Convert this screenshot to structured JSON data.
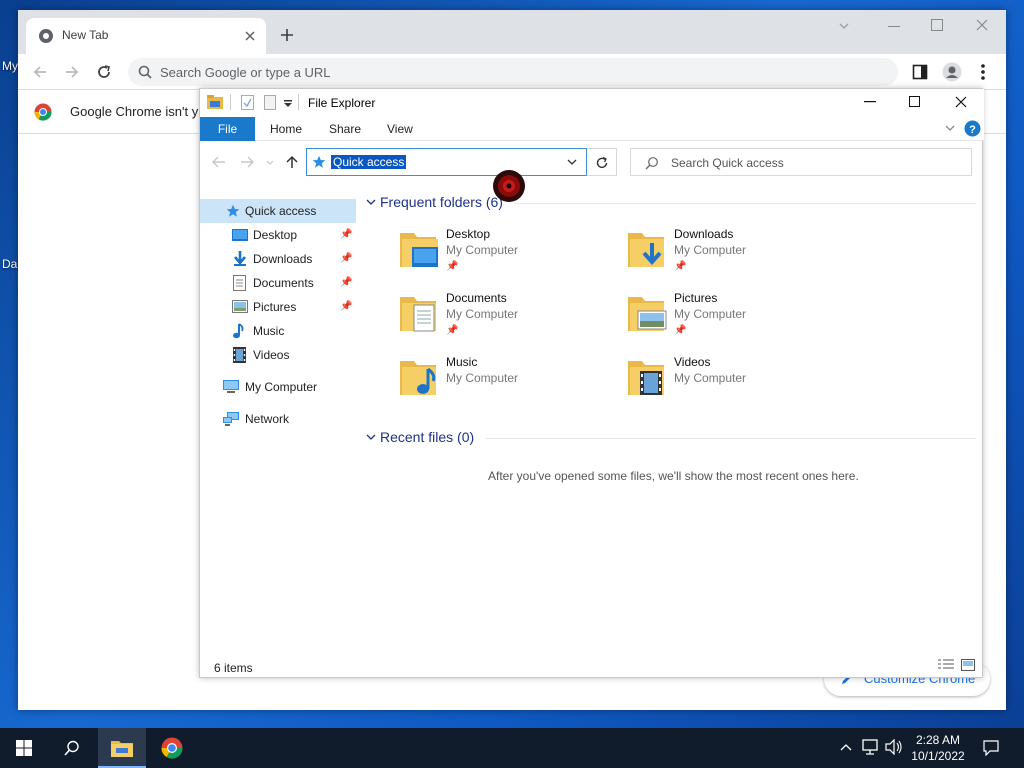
{
  "desktop": {
    "icon_label_1": "My",
    "icon_label_2": "Da"
  },
  "chrome": {
    "tab_title": "New Tab",
    "omnibox_placeholder": "Search Google or type a URL",
    "infobar_text": "Google Chrome isn't y",
    "customize_label": "Customize Chrome"
  },
  "explorer": {
    "window_title": "File Explorer",
    "ribbon_tabs": [
      "File",
      "Home",
      "Share",
      "View"
    ],
    "address": "Quick access",
    "search_placeholder": "Search Quick access",
    "nav_items": [
      {
        "label": "Quick access",
        "pinned": false
      },
      {
        "label": "Desktop",
        "pinned": true
      },
      {
        "label": "Downloads",
        "pinned": true
      },
      {
        "label": "Documents",
        "pinned": true
      },
      {
        "label": "Pictures",
        "pinned": true
      },
      {
        "label": "Music",
        "pinned": false
      },
      {
        "label": "Videos",
        "pinned": false
      },
      {
        "label": "My Computer",
        "pinned": false
      },
      {
        "label": "Network",
        "pinned": false
      }
    ],
    "frequent_header": "Frequent folders (6)",
    "folders": [
      {
        "name": "Desktop",
        "location": "My Computer"
      },
      {
        "name": "Downloads",
        "location": "My Computer"
      },
      {
        "name": "Documents",
        "location": "My Computer"
      },
      {
        "name": "Pictures",
        "location": "My Computer"
      },
      {
        "name": "Music",
        "location": "My Computer"
      },
      {
        "name": "Videos",
        "location": "My Computer"
      }
    ],
    "recent_header": "Recent files (0)",
    "recent_empty": "After you've opened some files, we'll show the most recent ones here.",
    "status": "6 items"
  },
  "taskbar": {
    "time": "2:28 AM",
    "date": "10/1/2022"
  }
}
